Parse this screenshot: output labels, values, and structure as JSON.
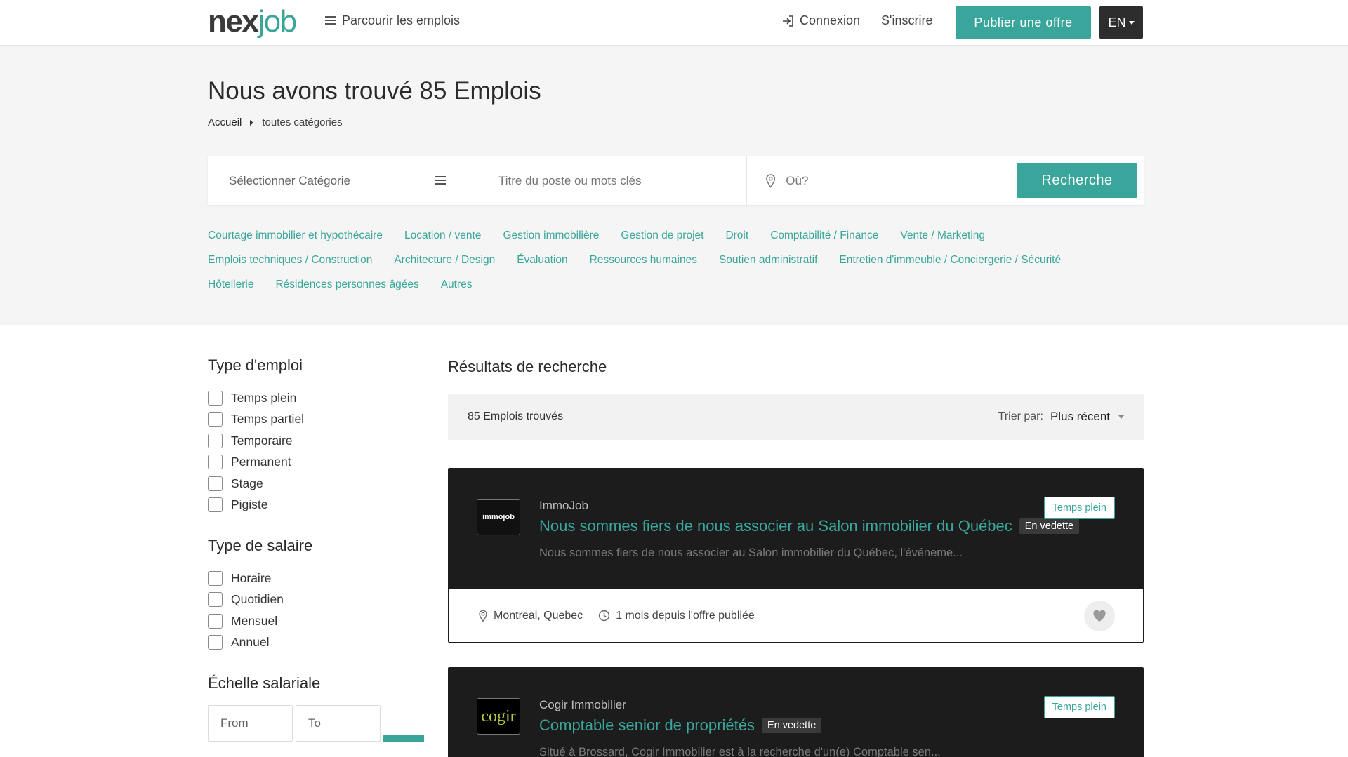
{
  "header": {
    "logo_part1": "nex",
    "logo_part2": "job",
    "browse_label": "Parcourir les emplois",
    "login_label": "Connexion",
    "signup_label": "S'inscrire",
    "post_label": "Publier une offre",
    "lang_label": "EN"
  },
  "hero": {
    "title": "Nous avons trouvé 85 Emplois",
    "breadcrumb": {
      "home": "Accueil",
      "current": "toutes catégories"
    }
  },
  "search": {
    "category_label": "Sélectionner Catégorie",
    "keywords_placeholder": "Titre du poste ou mots clés",
    "location_placeholder": "Où?",
    "button_label": "Recherche"
  },
  "categories": {
    "row1": [
      "Courtage immobilier et hypothécaire",
      "Location / vente",
      "Gestion immobilière",
      "Gestion de projet",
      "Droit",
      "Comptabilité / Finance",
      "Vente / Marketing"
    ],
    "row2": [
      "Emplois techniques / Construction",
      "Architecture / Design",
      "Évaluation",
      "Ressources humaines",
      "Soutien administratif",
      "Entretien d'immeuble / Conciergerie / Sécurité"
    ],
    "row3": [
      "Hôtellerie",
      "Résidences personnes âgées",
      "Autres"
    ]
  },
  "filters": {
    "job_type": {
      "title": "Type d'emploi",
      "options": [
        "Temps plein",
        "Temps partiel",
        "Temporaire",
        "Permanent",
        "Stage",
        "Pigiste"
      ]
    },
    "salary_type": {
      "title": "Type de salaire",
      "options": [
        "Horaire",
        "Quotidien",
        "Mensuel",
        "Annuel"
      ]
    },
    "salary_range": {
      "title": "Échelle salariale",
      "from_placeholder": "From",
      "to_placeholder": "To"
    }
  },
  "results": {
    "title": "Résultats de recherche",
    "count_label": "85 Emplois trouvés",
    "sort_label": "Trier par:",
    "sort_value": "Plus récent"
  },
  "jobs": [
    {
      "company": "ImmoJob",
      "logo_text": "immojob",
      "title": "Nous sommes fiers de nous associer au Salon immobilier du Québec",
      "featured": "En vedette",
      "description": "Nous sommes fiers de nous associer au Salon immobilier du Québec, l'événeme...",
      "type": "Temps plein",
      "location": "Montreal, Quebec",
      "posted": "1 mois depuis l'offre publiée"
    },
    {
      "company": "Cogir Immobilier",
      "logo_text": "cogir",
      "title": "Comptable senior de propriétés",
      "featured": "En vedette",
      "description": "Situé à Brossard, Cogir Immobilier est à la recherche d'un(e) Comptable sen...",
      "type": "Temps plein"
    }
  ],
  "colors": {
    "accent": "#3aa69b",
    "dark": "#1c1c1c",
    "hero_bg": "#f5f5f5"
  }
}
